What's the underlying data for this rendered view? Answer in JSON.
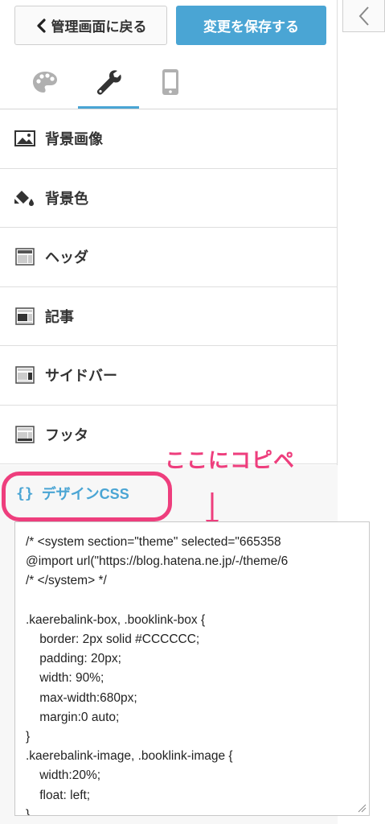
{
  "header": {
    "back_label": "管理画面に戻る",
    "save_label": "変更を保存する",
    "back_icon": "chevron-left-icon",
    "collapse_icon": "chevron-left-icon"
  },
  "tabs": [
    {
      "name": "design",
      "icon": "palette-icon",
      "active": false
    },
    {
      "name": "customize",
      "icon": "wrench-icon",
      "active": true
    },
    {
      "name": "smartphone",
      "icon": "smartphone-icon",
      "active": false
    }
  ],
  "menu": {
    "items": [
      {
        "label": "背景画像",
        "icon": "image-icon"
      },
      {
        "label": "背景色",
        "icon": "paint-bucket-icon"
      },
      {
        "label": "ヘッダ",
        "icon": "header-layout-icon"
      },
      {
        "label": "記事",
        "icon": "article-layout-icon"
      },
      {
        "label": "サイドバー",
        "icon": "sidebar-layout-icon"
      },
      {
        "label": "フッタ",
        "icon": "footer-layout-icon"
      }
    ]
  },
  "css_section": {
    "braces": "{}",
    "title": "デザインCSS",
    "annotation": "ここにコピペ",
    "code": "/* <system section=\"theme\" selected=\"665358\n@import url(\"https://blog.hatena.ne.jp/-/theme/6\n/* </system> */\n\n.kaerebalink-box, .booklink-box {\n    border: 2px solid #CCCCCC;\n    padding: 20px;\n    width: 90%;\n    max-width:680px;\n    margin:0 auto;\n}\n.kaerebalink-image, .booklink-image {\n    width:20%;\n    float: left;\n}"
  },
  "colors": {
    "accent": "#4aa5d4",
    "annotation": "#ee3e7d"
  }
}
